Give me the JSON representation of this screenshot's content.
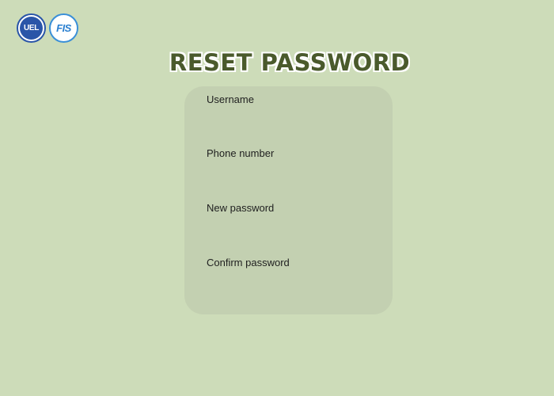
{
  "header": {
    "logos": [
      {
        "text": "UEL",
        "icon": "uel-logo"
      },
      {
        "text": "FIS",
        "icon": "fis-logo"
      }
    ],
    "title": "RESET PASSWORD"
  },
  "form": {
    "fields": [
      {
        "label": "Username",
        "value": "",
        "placeholder": ""
      },
      {
        "label": "Phone number",
        "value": "",
        "placeholder": ""
      },
      {
        "label": "New password",
        "value": "",
        "placeholder": ""
      },
      {
        "label": "Confirm password",
        "value": "",
        "placeholder": ""
      }
    ]
  },
  "colors": {
    "background": "#cddcb9",
    "card": "#c3d0b1",
    "title": "#4a5a2c"
  }
}
